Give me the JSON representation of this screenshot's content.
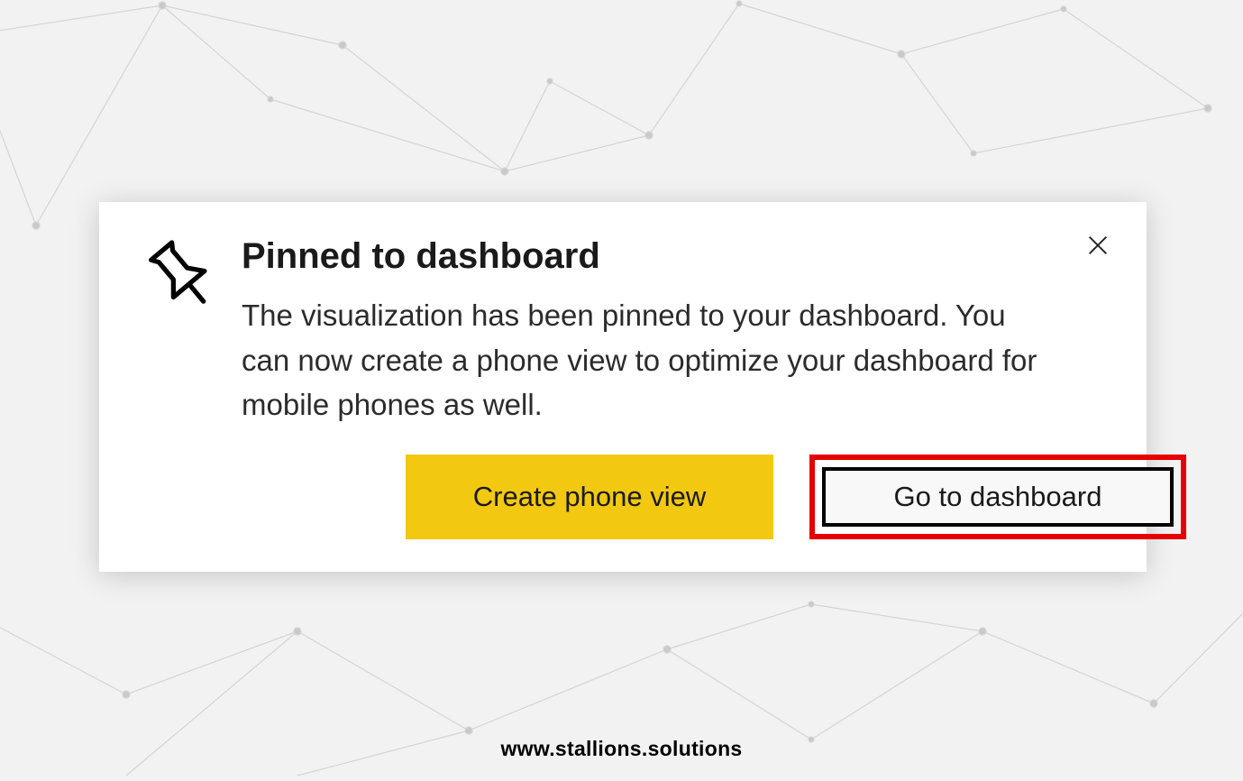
{
  "dialog": {
    "title": "Pinned to dashboard",
    "body": "The visualization has been pinned to your dashboard. You can now create a phone view to optimize your dashboard for mobile phones as well.",
    "primary_button": "Create phone view",
    "secondary_button": "Go to dashboard"
  },
  "watermark": "www.stallions.solutions"
}
